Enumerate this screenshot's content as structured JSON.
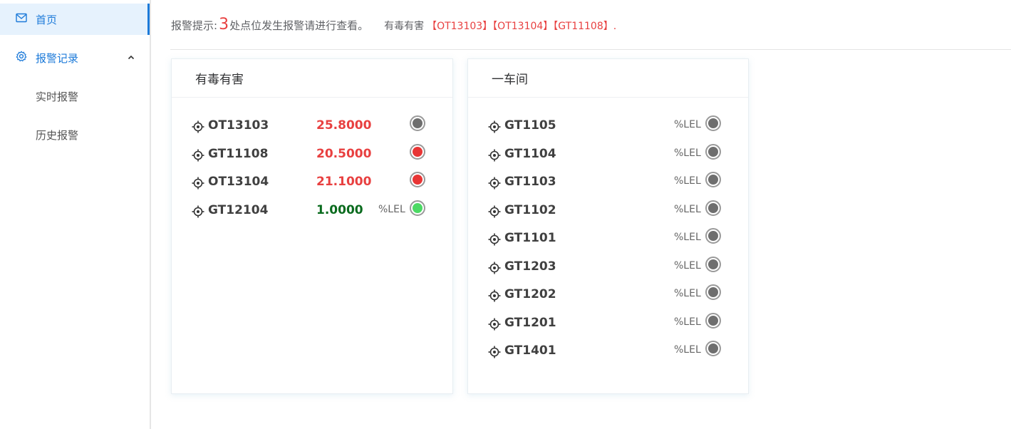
{
  "sidebar": {
    "home_label": "首页",
    "alarm_label": "报警记录",
    "sub_items": [
      "实时报警",
      "历史报警"
    ]
  },
  "alert": {
    "prefix": "报警提示:",
    "count": "3",
    "suffix": "处点位发生报警请进行查看。",
    "category": "有毒有害",
    "tags": "【OT13103】【OT13104】【GT11108】."
  },
  "colors": {
    "accent": "#1c7ad9",
    "alarm_red": "#e84040",
    "normal_green": "#0a6b1e",
    "led_gray": "#6e6e6e",
    "led_red": "#e83535",
    "led_green": "#4cd964"
  },
  "card1": {
    "title": "有毒有害",
    "rows": [
      {
        "name": "OT13103",
        "value": "25.8000",
        "unit": "",
        "status": "gray",
        "value_color": "red"
      },
      {
        "name": "GT11108",
        "value": "20.5000",
        "unit": "",
        "status": "red",
        "value_color": "red"
      },
      {
        "name": "OT13104",
        "value": "21.1000",
        "unit": "",
        "status": "red",
        "value_color": "red"
      },
      {
        "name": "GT12104",
        "value": "1.0000",
        "unit": "%LEL",
        "status": "green",
        "value_color": "green"
      }
    ]
  },
  "card2": {
    "title": "一车间",
    "rows": [
      {
        "name": "GT1105",
        "unit": "%LEL",
        "status": "gray"
      },
      {
        "name": "GT1104",
        "unit": "%LEL",
        "status": "gray"
      },
      {
        "name": "GT1103",
        "unit": "%LEL",
        "status": "gray"
      },
      {
        "name": "GT1102",
        "unit": "%LEL",
        "status": "gray"
      },
      {
        "name": "GT1101",
        "unit": "%LEL",
        "status": "gray"
      },
      {
        "name": "GT1203",
        "unit": "%LEL",
        "status": "gray"
      },
      {
        "name": "GT1202",
        "unit": "%LEL",
        "status": "gray"
      },
      {
        "name": "GT1201",
        "unit": "%LEL",
        "status": "gray"
      },
      {
        "name": "GT1401",
        "unit": "%LEL",
        "status": "gray"
      }
    ]
  }
}
